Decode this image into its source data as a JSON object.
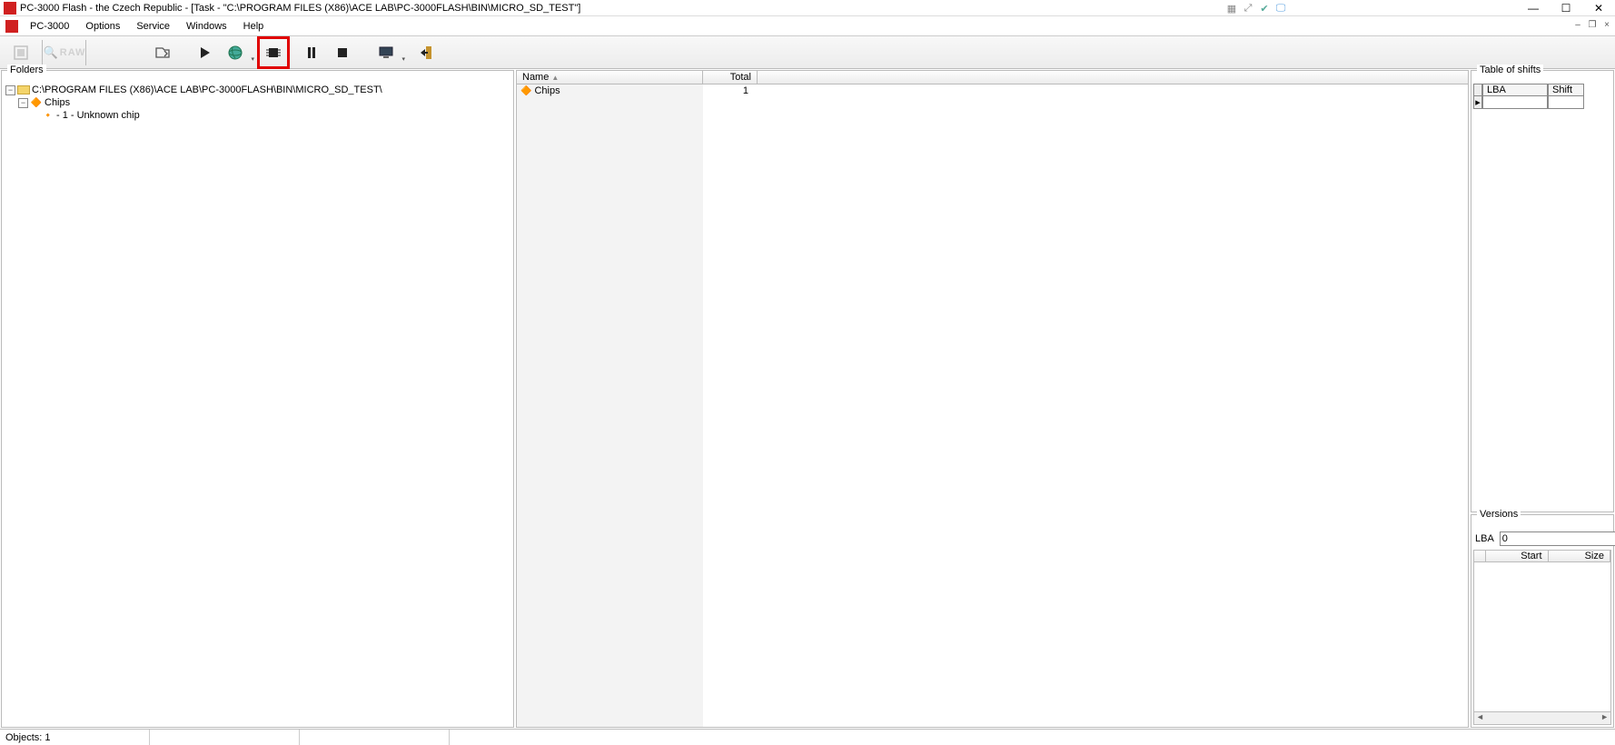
{
  "titlebar": {
    "title": "PC-3000 Flash - the Czech Republic - [Task - \"C:\\PROGRAM FILES (X86)\\ACE LAB\\PC-3000FLASH\\BIN\\MICRO_SD_TEST\"]"
  },
  "menu": {
    "items": [
      "PC-3000",
      "Options",
      "Service",
      "Windows",
      "Help"
    ]
  },
  "toolbar": {
    "raw_label": "RAW"
  },
  "folders": {
    "panel_label": "Folders",
    "root": "C:\\PROGRAM FILES (X86)\\ACE LAB\\PC-3000FLASH\\BIN\\MICRO_SD_TEST\\",
    "child1": "Chips",
    "child2": "  - 1 - Unknown chip"
  },
  "center": {
    "col_name": "Name",
    "col_total": "Total",
    "row1_name": "Chips",
    "row1_total": "1"
  },
  "shifts": {
    "panel_label": "Table of shifts",
    "col_lba": "LBA",
    "col_shift": "Shift"
  },
  "versions": {
    "panel_label": "Versions",
    "lba_label": "LBA",
    "lba_value": "0",
    "col_start": "Start",
    "col_size": "Size"
  },
  "statusbar": {
    "objects": "Objects: 1"
  }
}
